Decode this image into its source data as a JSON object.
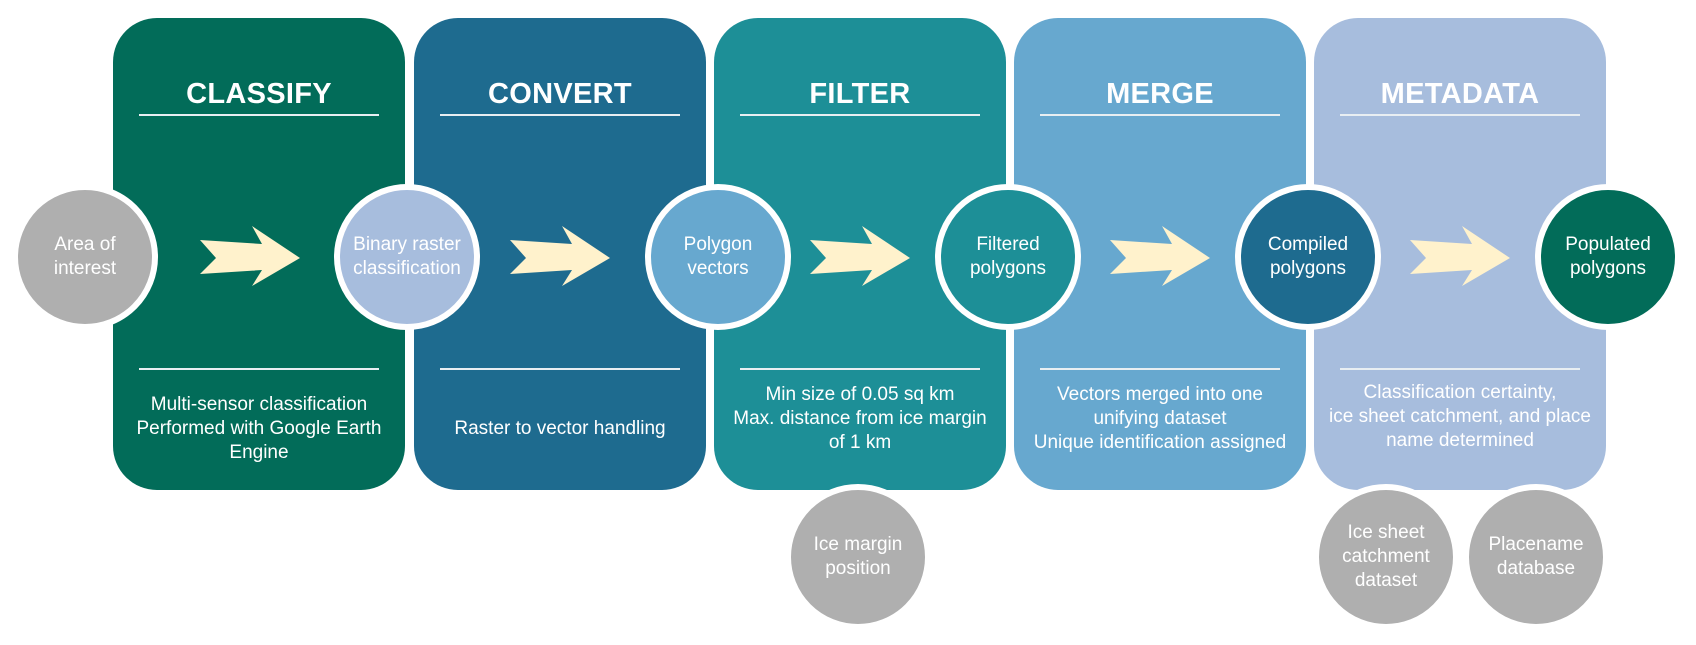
{
  "colors": {
    "classify": "#026c59",
    "convert": "#1e6b8f",
    "filter": "#1d8f97",
    "merge": "#67a8cf",
    "metadata": "#a7bddd",
    "input_gray": "#afafaf",
    "arrow": "#fff2cc",
    "text": "#ffffff"
  },
  "stages": [
    {
      "title": "CLASSIFY",
      "description": [
        "Multi-sensor classification",
        "Performed with Google Earth",
        "Engine"
      ]
    },
    {
      "title": "CONVERT",
      "description": [
        "Raster to vector handling"
      ]
    },
    {
      "title": "FILTER",
      "description": [
        "Min size of 0.05 sq km",
        "Max. distance from ice margin",
        "of 1 km"
      ]
    },
    {
      "title": "MERGE",
      "description": [
        "Vectors merged into one",
        "unifying dataset",
        "Unique identification assigned"
      ]
    },
    {
      "title": "METADATA",
      "description": [
        "Classification certainty,",
        "ice sheet catchment, and place",
        "name determined"
      ]
    }
  ],
  "nodes": [
    {
      "label": [
        "Area of",
        "interest"
      ]
    },
    {
      "label": [
        "Binary raster",
        "classification"
      ]
    },
    {
      "label": [
        "Polygon",
        "vectors"
      ]
    },
    {
      "label": [
        "Filtered",
        "polygons"
      ]
    },
    {
      "label": [
        "Compiled",
        "polygons"
      ]
    },
    {
      "label": [
        "Populated",
        "polygons"
      ]
    }
  ],
  "inputs": [
    {
      "label": [
        "Ice margin",
        "position"
      ]
    },
    {
      "label": [
        "Ice sheet",
        "catchment",
        "dataset"
      ]
    },
    {
      "label": [
        "Placename",
        "database"
      ]
    }
  ],
  "arrows": [
    "arrow-right",
    "arrow-right",
    "arrow-right",
    "arrow-right",
    "arrow-right"
  ]
}
